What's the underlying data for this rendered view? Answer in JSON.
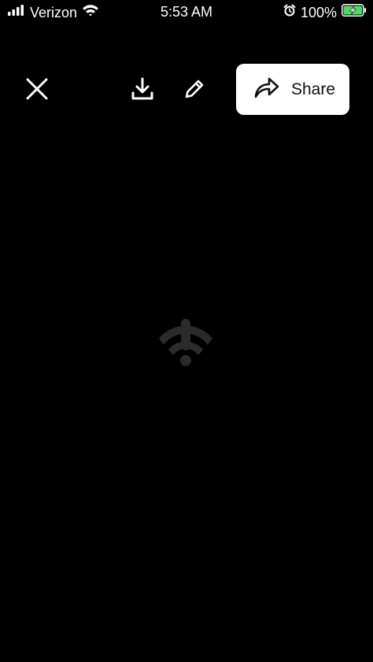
{
  "status_bar": {
    "carrier": "Verizon",
    "time": "5:53 AM",
    "battery_percent": "100%",
    "icons": [
      "signal-bars-icon",
      "wifi-icon",
      "alarm-icon",
      "battery-charging-icon"
    ]
  },
  "toolbar": {
    "close_icon": "close-icon",
    "download_icon": "download-icon",
    "edit_icon": "pencil-icon",
    "share_label": "Share",
    "share_icon": "share-arrow-icon"
  },
  "main": {
    "state_icon": "no-connection-icon"
  },
  "colors": {
    "background": "#000000",
    "foreground": "#ffffff",
    "share_button_bg": "#ffffff",
    "share_button_text": "#111111",
    "battery_fill": "#4cd964",
    "muted_icon": "#2b2b2b"
  }
}
